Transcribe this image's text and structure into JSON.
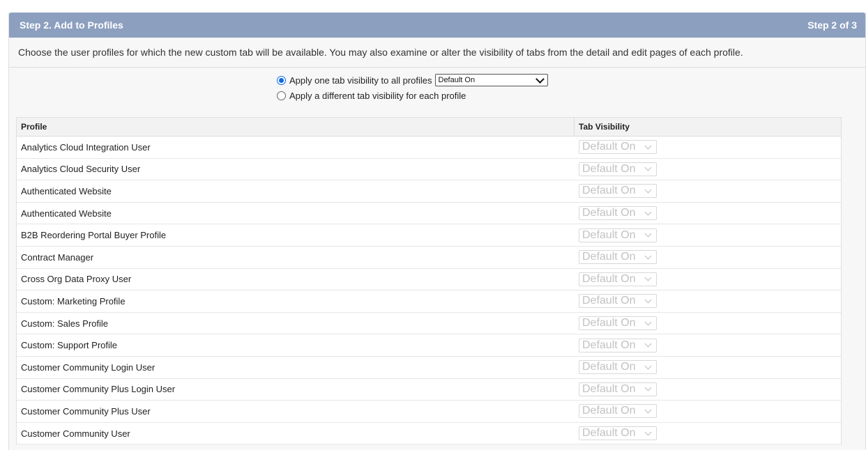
{
  "header": {
    "title": "Step 2. Add to Profiles",
    "step": "Step 2 of 3"
  },
  "description": "Choose the user profiles for which the new custom tab will be available. You may also examine or alter the visibility of tabs from the detail and edit pages of each profile.",
  "options": {
    "apply_all_label": "Apply one tab visibility to all profiles",
    "apply_all_selected": true,
    "global_visibility_value": "Default On",
    "apply_each_label": "Apply a different tab visibility for each profile",
    "apply_each_selected": false
  },
  "table": {
    "columns": [
      "Profile",
      "Tab Visibility"
    ],
    "rows": [
      {
        "profile": "Analytics Cloud Integration User",
        "visibility": "Default On"
      },
      {
        "profile": "Analytics Cloud Security User",
        "visibility": "Default On"
      },
      {
        "profile": "Authenticated Website",
        "visibility": "Default On"
      },
      {
        "profile": "Authenticated Website",
        "visibility": "Default On"
      },
      {
        "profile": "B2B Reordering Portal Buyer Profile",
        "visibility": "Default On"
      },
      {
        "profile": "Contract Manager",
        "visibility": "Default On"
      },
      {
        "profile": "Cross Org Data Proxy User",
        "visibility": "Default On"
      },
      {
        "profile": "Custom: Marketing Profile",
        "visibility": "Default On"
      },
      {
        "profile": "Custom: Sales Profile",
        "visibility": "Default On"
      },
      {
        "profile": "Custom: Support Profile",
        "visibility": "Default On"
      },
      {
        "profile": "Customer Community Login User",
        "visibility": "Default On"
      },
      {
        "profile": "Customer Community Plus Login User",
        "visibility": "Default On"
      },
      {
        "profile": "Customer Community Plus User",
        "visibility": "Default On"
      },
      {
        "profile": "Customer Community User",
        "visibility": "Default On"
      }
    ]
  },
  "colors": {
    "header_bg": "#8c9fbf",
    "radio_accent": "#0b69e6",
    "disabled_text": "#c2c2c2"
  }
}
